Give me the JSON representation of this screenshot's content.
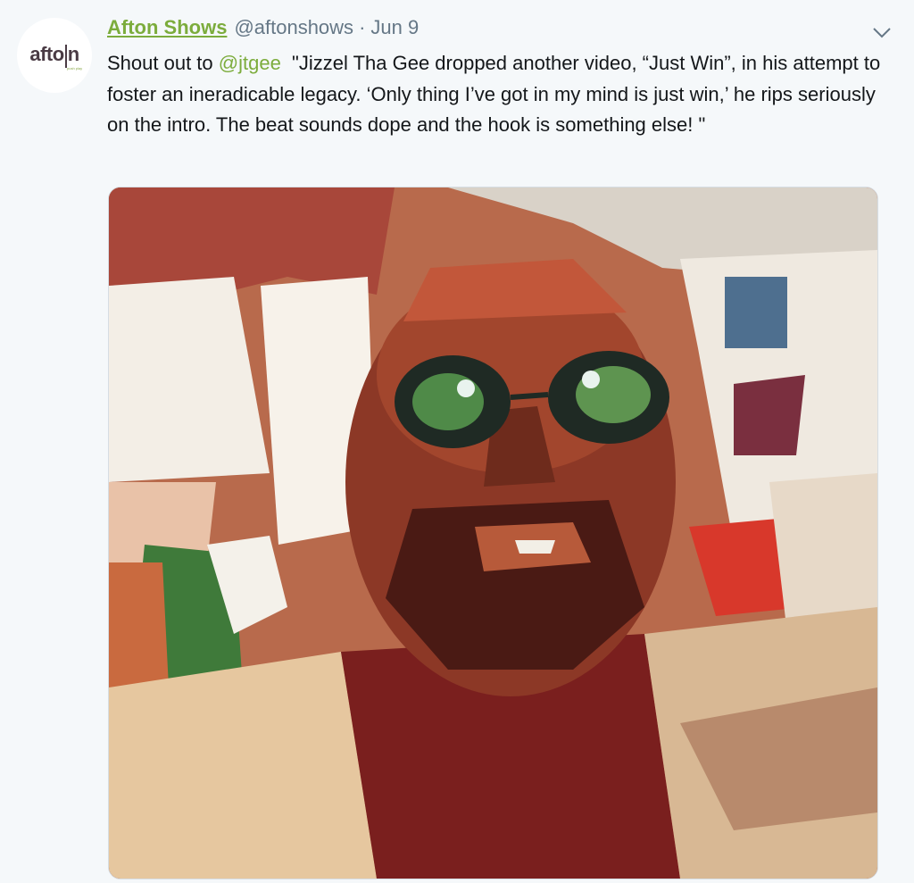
{
  "tweet": {
    "author_name": "Afton Shows",
    "author_handle": "@aftonshows",
    "separator": "·",
    "date": "Jun 9",
    "text_prefix": "Shout out to ",
    "mention": "@jtgee",
    "text_body": "  \"Jizzel Tha Gee dropped another video, “Just Win”, in his attempt to foster an ineradicable legacy. ‘Only thing I’ve got in my mind is just win,’ he rips seriously on the intro. The beat sounds dope and the hook is something else! \""
  },
  "avatar": {
    "logo_text_left": "afto",
    "logo_text_right": "n",
    "logo_subtext": "push play"
  },
  "colors": {
    "accent": "#7cac3c",
    "muted": "#657786",
    "background": "#f5f8fa"
  },
  "icons": {
    "menu": "chevron-down-icon"
  }
}
